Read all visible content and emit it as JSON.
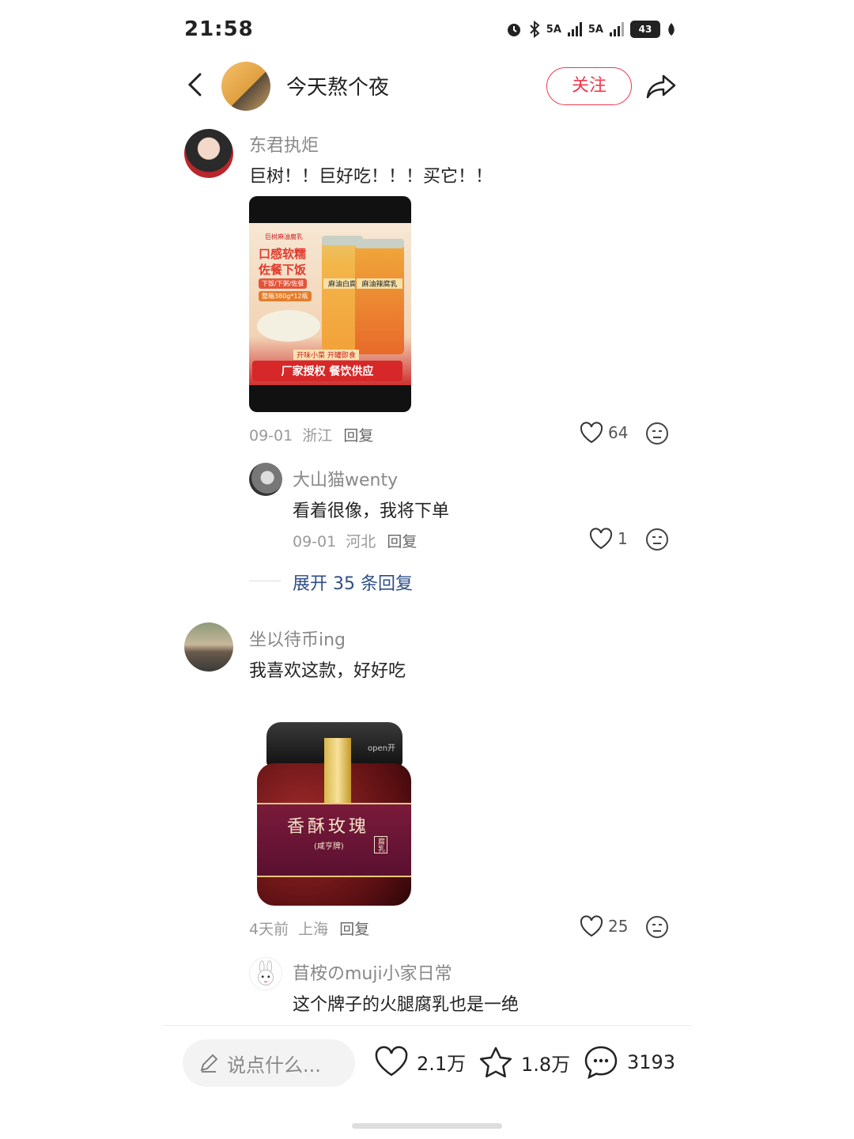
{
  "status_bar": {
    "time": "21:58",
    "net1": "5A",
    "net2": "5A",
    "battery": "43"
  },
  "header": {
    "title": "今天熬个夜",
    "follow_label": "关注"
  },
  "comments": [
    {
      "user": "东君执炬",
      "text": "巨树！！巨好吃！！！买它！！",
      "image": {
        "brand": "巨树麻油腐乳",
        "headline1": "口感软糯",
        "headline2": "佐餐下饭",
        "tag": "下饭/下粥/佐餐",
        "spec": "整箱380g*12瓶",
        "jar1": "麻油白腐",
        "jar2": "麻油辣腐乳",
        "slogan_small": "开味小菜 开罐即食",
        "slogan_big": "厂家授权 餐饮供应"
      },
      "date": "09-01",
      "location": "浙江",
      "reply_label": "回复",
      "likes": "64",
      "replies": [
        {
          "user": "大山猫wenty",
          "text": "看着很像，我将下单",
          "date": "09-01",
          "location": "河北",
          "reply_label": "回复",
          "likes": "1"
        }
      ],
      "expand_label": "展开 35 条回复"
    },
    {
      "user": "坐以待币ing",
      "text": "我喜欢这款，好好吃",
      "image": {
        "label": "香酥玫瑰",
        "sub": "(咸亨牌)",
        "badge": "腐乳",
        "open": "open开"
      },
      "date": "4天前",
      "location": "上海",
      "reply_label": "回复",
      "likes": "25",
      "replies": [
        {
          "user": "苜桉のmuji小家日常",
          "text": "这个牌子的火腿腐乳也是一绝"
        }
      ]
    }
  ],
  "bottom_bar": {
    "placeholder": "说点什么...",
    "likes": "2.1万",
    "favorites": "1.8万",
    "comments": "3193"
  },
  "colors": {
    "accent": "#f0384e",
    "link": "#2e4e86"
  }
}
